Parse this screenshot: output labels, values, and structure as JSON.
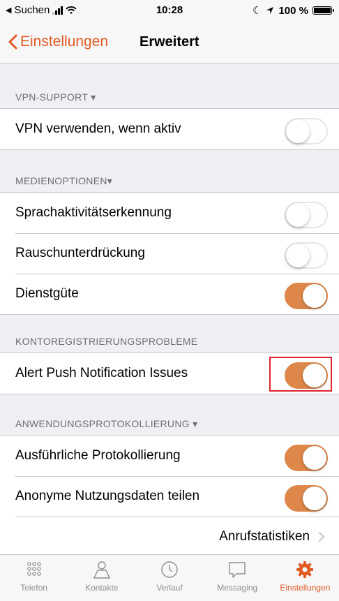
{
  "status_bar": {
    "back_app": "Suchen",
    "time": "10:28",
    "battery": "100 %"
  },
  "nav": {
    "back_label": "Einstellungen",
    "title": "Erweitert"
  },
  "sections": [
    {
      "header": "VPN-SUPPORT ▾",
      "rows": [
        {
          "label": "VPN verwenden, wenn aktiv",
          "on": false
        }
      ]
    },
    {
      "header": "MEDIENOPTIONEN▾",
      "rows": [
        {
          "label": "Sprachaktivitätserkennung",
          "on": false
        },
        {
          "label": "Rauschunterdrückung",
          "on": false
        },
        {
          "label": "Dienstgüte",
          "on": true
        }
      ]
    },
    {
      "header": "KONTOREGISTRIERUNGSPROBLEME",
      "rows": [
        {
          "label": "Alert Push Notification Issues",
          "on": true
        }
      ]
    },
    {
      "header": "ANWENDUNGSPROTOKOLLIERUNG ▾",
      "rows": [
        {
          "label": "Ausführliche Protokollierung",
          "on": true
        },
        {
          "label": "Anonyme Nutzungsdaten teilen",
          "on": true
        }
      ],
      "link": "Anrufstatistiken"
    }
  ],
  "tabs": [
    {
      "label": "Telefon",
      "icon": "keypad-icon"
    },
    {
      "label": "Kontakte",
      "icon": "person-icon"
    },
    {
      "label": "Verlauf",
      "icon": "clock-icon"
    },
    {
      "label": "Messaging",
      "icon": "chat-bubble-icon"
    },
    {
      "label": "Einstellungen",
      "icon": "gear-icon",
      "active": true
    }
  ],
  "colors": {
    "accent": "#e05a24",
    "toggle_on": "#dd884a",
    "highlight": "#e0232e"
  }
}
